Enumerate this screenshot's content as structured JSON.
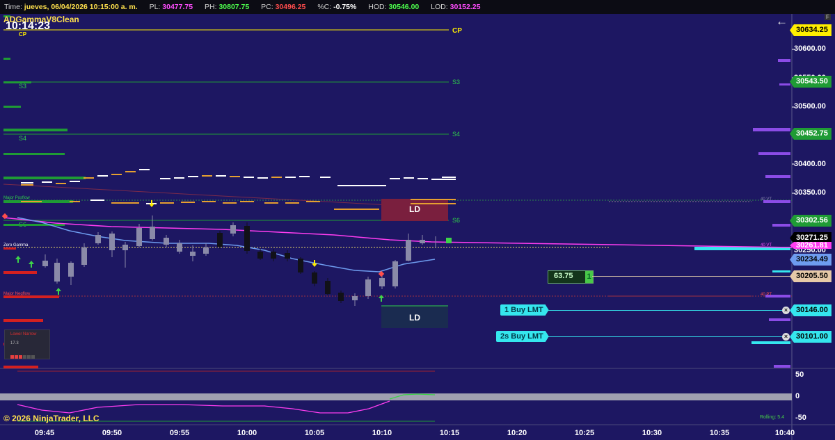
{
  "header": {
    "time_label": "Time:",
    "time_value": "jueves, 06/04/2026 10:15:00 a. m.",
    "pl_label": "PL:",
    "pl_value": "30477.75",
    "ph_label": "PH:",
    "ph_value": "30807.75",
    "pc_label": "PC:",
    "pc_value": "30496.25",
    "pctc_label": "%C:",
    "pctc_value": "-0.75%",
    "hod_label": "HOD:",
    "hod_value": "30546.00",
    "lod_label": "LOD:",
    "lod_value": "30152.25"
  },
  "indicator_name": "ADGammaV8Clean",
  "clock": "10:14:23",
  "copyright": "© 2026 NinjaTrader, LLC",
  "level_labels": {
    "cp": "CP",
    "s3": "S3",
    "s4": "S4",
    "s6": "S6",
    "major_posflow": "Major Posflow",
    "zero_gamma": "Zero Gamma",
    "major_negflow": "Major Negflow",
    "ld": "LD"
  },
  "small_labels": {
    "vt1": "40 VT",
    "vt2": "40 VT",
    "pt": "40 PT"
  },
  "lower_panel": {
    "title": "Lower Narrow",
    "value": "17.3"
  },
  "price_axis": {
    "labels": [
      "30600.00",
      "30550.00",
      "30500.00",
      "30400.00",
      "30350.00",
      "30250.00"
    ],
    "tags": [
      {
        "text": "30634.25",
        "bg": "#ffee00",
        "fg": "#000000"
      },
      {
        "text": "30543.50",
        "bg": "#1f9b35",
        "fg": "#ffffff"
      },
      {
        "text": "30452.75",
        "bg": "#1f9b35",
        "fg": "#ffffff"
      },
      {
        "text": "30302.56",
        "bg": "#1f9b35",
        "fg": "#ffffff"
      },
      {
        "text": "30271.25",
        "bg": "#000000",
        "fg": "#ffffff"
      },
      {
        "text": "30261.81",
        "bg": "#ff3df0",
        "fg": "#ffffff"
      },
      {
        "text": "30234.49",
        "bg": "#6e9cef",
        "fg": "#000000"
      },
      {
        "text": "30205.50",
        "bg": "#e6c9a8",
        "fg": "#000000"
      },
      {
        "text": "30146.00",
        "bg": "#35e6ee",
        "fg": "#000000"
      },
      {
        "text": "30101.00",
        "bg": "#35e6ee",
        "fg": "#000000"
      }
    ]
  },
  "marker": {
    "value": "63.75",
    "badge": "1"
  },
  "orders": [
    {
      "label": "1 Buy LMT",
      "close": "×"
    },
    {
      "label": "2s Buy LMT",
      "close": "×"
    }
  ],
  "osc_axis": {
    "labels": [
      "50",
      "0",
      "-50"
    ]
  },
  "rolling": "Rolling: 5.4",
  "time_axis": {
    "labels": [
      "09:45",
      "09:50",
      "09:55",
      "10:00",
      "10:05",
      "10:10",
      "10:15",
      "10:20",
      "10:25",
      "10:30",
      "10:35",
      "10:40"
    ]
  },
  "icons": {
    "back": "left-arrow-icon",
    "settings": "f-button"
  },
  "colors": {
    "background": "#1d1762",
    "gamma_line": "#ff3df0",
    "vwap_line": "#6e9cef",
    "cp_line": "#ffee00",
    "support_line": "#1f9b35"
  }
}
